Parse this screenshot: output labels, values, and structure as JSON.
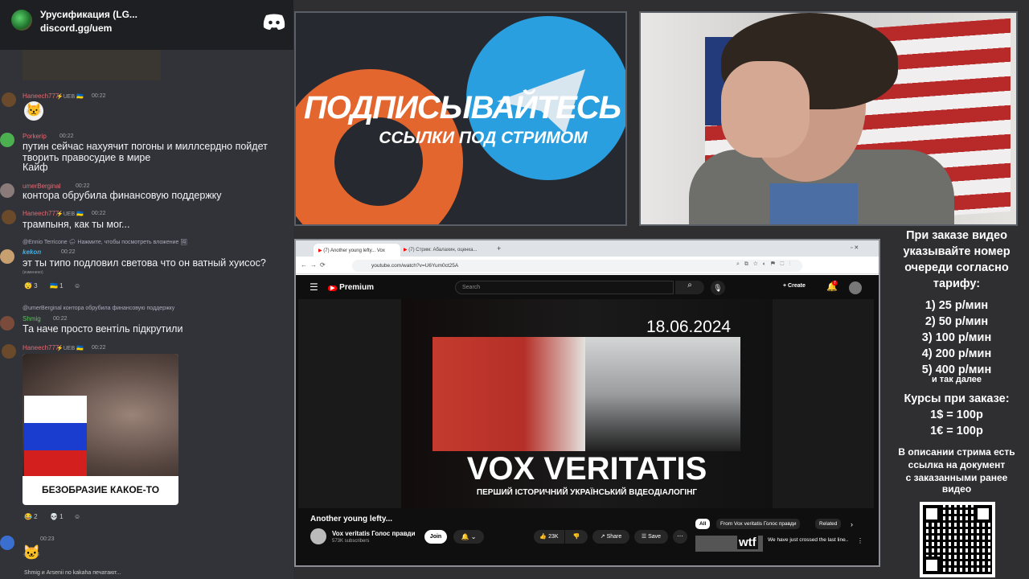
{
  "discord": {
    "server_name": "Урусификация (LG...",
    "invite": "discord.gg/uem",
    "messages": [
      {
        "user": "Haneech777",
        "badges": "⚡UEB 🇺🇦",
        "time": "00:22",
        "text": ""
      },
      {
        "user": "Porkerip",
        "badges": "",
        "time": "00:22",
        "text": "путин сейчас нахуячит погоны и миллсердно пойдет творить правосудие в мире",
        "text2": "Кайф"
      },
      {
        "user": "umerBerginal",
        "badges": "",
        "time": "00:22",
        "text": "контора обрубила финансовую поддержку"
      },
      {
        "user": "Haneech777",
        "badges": "⚡UEB 🇺🇦",
        "time": "00:22",
        "text": "трампыня, как ты мог..."
      },
      {
        "reply": "@Ennio Terricone 🌧 Нажмите, чтобы посмотреть вложение 🖼",
        "user": "kekon",
        "badges": "",
        "time": "00:22",
        "text": "эт ты типо подловил светова что он ватный хуисос?",
        "edited": "(изменено)",
        "reactions": [
          "😴 3",
          "🇺🇦 1",
          "☺"
        ]
      },
      {
        "reply": "@umerBerginal контора обрубила финансовую поддержку",
        "user": "Shmig",
        "badges": "",
        "time": "00:22",
        "text": "Та наче просто вентіль підкрутили"
      },
      {
        "user": "Haneech777",
        "badges": "⚡UEB 🇺🇦",
        "time": "00:22",
        "text": "",
        "image_caption": "БЕЗОБРАЗИЕ КАКОЕ-ТО",
        "reactions": [
          "😂 2",
          "💀 1",
          "☺"
        ]
      },
      {
        "user": "",
        "badges": "",
        "time": "00:23",
        "text": ""
      }
    ],
    "typing": "Shmig и Arsenii no kakaha печатают..."
  },
  "promo": {
    "line1": "ПОДПИСЫВАЙТЕСЬ",
    "line2": "ССЫЛКИ ПОД СТРИМОМ"
  },
  "browser": {
    "tab1": "(7) Another young lefty... Vox",
    "tab2": "(7) Стрим: Абалахин, оценка...",
    "url": "youtube.com/watch?v=U6Yum0ct25A",
    "yt_logo": "Premium",
    "search_placeholder": "Search",
    "create": "Create",
    "notif_count": "7",
    "video_date": "18.06.2024",
    "video_title_overlay": "VOX VERITATIS",
    "video_subtitle_overlay": "ПЕРШИЙ ІСТОРИЧНИЙ УКРАЇНСЬКИЙ ВІДЕОДІАЛОГІНГ",
    "video_title": "Another young lefty...",
    "channel": "Vox veritatis Голос правди",
    "subscribers": "573K subscribers",
    "join": "Join",
    "likes": "23K",
    "share": "Share",
    "save": "Save",
    "chips": [
      "All",
      "From Vox veritatis Голос правди",
      "Related"
    ],
    "rec_title": "We have just crossed the last line..",
    "rec_thumb": "wtf"
  },
  "sidebar": {
    "intro": [
      "При заказе видео",
      "указывайте номер",
      "очереди согласно",
      "тарифу:"
    ],
    "tariffs": [
      "1) 25 р/мин",
      "2) 50 р/мин",
      "3) 100 р/мин",
      "4) 200 р/мин",
      "5) 400 р/мин"
    ],
    "etc": "и так далее",
    "rates_title": "Курсы при заказе:",
    "rates": [
      "1$ = 100р",
      "1€ = 100р"
    ],
    "desc": [
      "В описании стрима есть",
      "ссылка на документ",
      "с заказанными ранее",
      "видео"
    ]
  }
}
